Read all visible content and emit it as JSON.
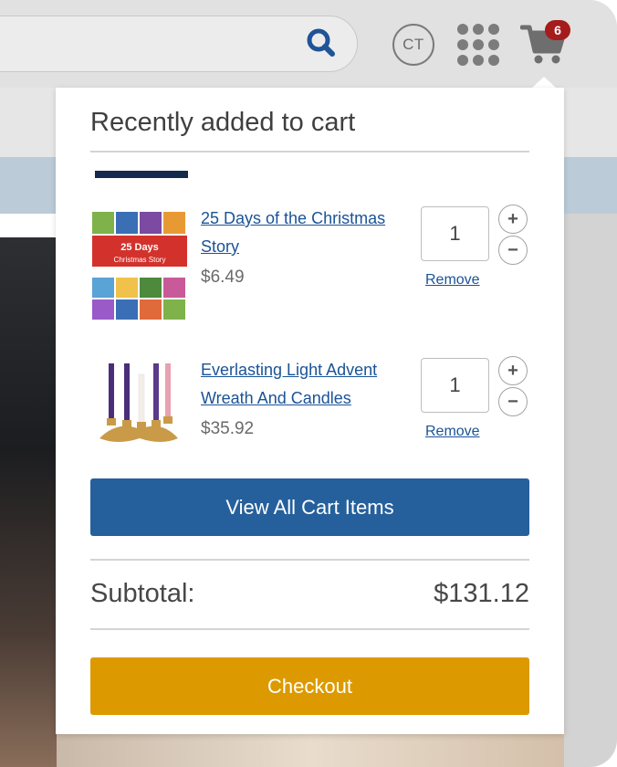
{
  "header": {
    "avatar_initials": "CT",
    "cart_count": "6"
  },
  "popup": {
    "title": "Recently added to cart",
    "items": [
      {
        "title": "25 Days of the Christmas Story",
        "price": "$6.49",
        "quantity": "1",
        "remove_label": "Remove",
        "increment": "+",
        "decrement": "−",
        "thumb_text": "25 Days of the Christmas Story"
      },
      {
        "title": "Everlasting Light Advent Wreath And Candles",
        "price": "$35.92",
        "quantity": "1",
        "remove_label": "Remove",
        "increment": "+",
        "decrement": "−"
      }
    ],
    "view_all_label": "View All Cart Items",
    "subtotal_label": "Subtotal:",
    "subtotal_value": "$131.12",
    "checkout_label": "Checkout"
  },
  "colors": {
    "primary_blue": "#25609c",
    "checkout_gold": "#dc9a00",
    "link_blue": "#1a5397",
    "badge_red": "#a51c1c"
  },
  "icons": [
    "search-icon",
    "apps-grid-icon",
    "shopping-cart-icon",
    "plus-icon",
    "minus-icon"
  ]
}
